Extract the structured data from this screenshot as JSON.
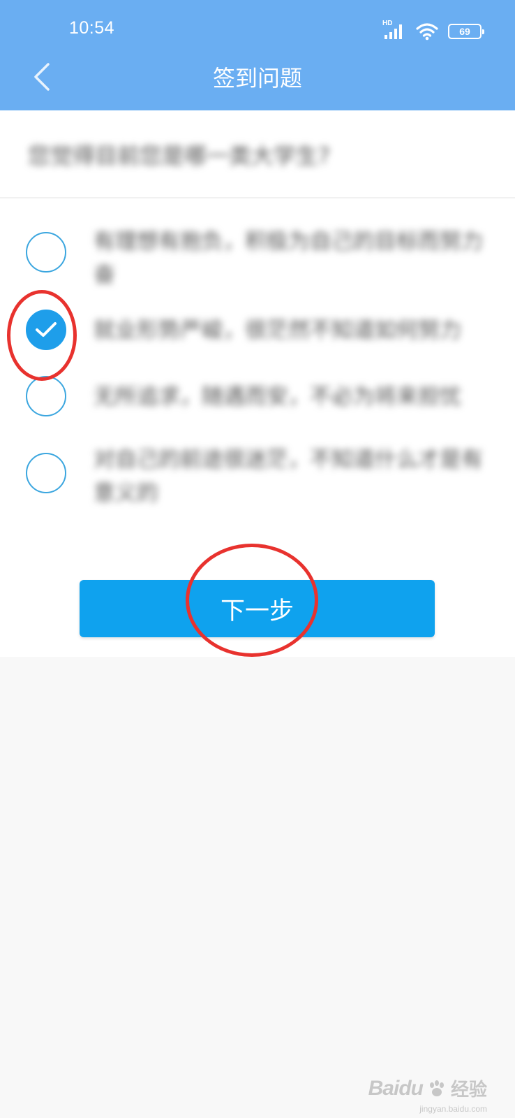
{
  "status_bar": {
    "time": "10:54",
    "network_label": "HD",
    "battery_level": "69"
  },
  "header": {
    "title": "签到问题"
  },
  "question": {
    "text": "您觉得目前您是哪一类大学生?"
  },
  "options": [
    {
      "text": "有理想有抱负，积极为自己的目标而努力奋",
      "checked": false
    },
    {
      "text": "就业形势严峻，很茫然不知道如何努力",
      "checked": true
    },
    {
      "text": "无所追求，随遇而安，不必为将来担忧",
      "checked": false
    },
    {
      "text": "对自己的前途很迷茫，不知道什么才是有意义的",
      "checked": false
    }
  ],
  "next_button": {
    "label": "下一步"
  },
  "watermark": {
    "logo_text": "Baidu",
    "cn_text": "经验",
    "url": "jingyan.baidu.com"
  },
  "colors": {
    "header_bg": "#6aaef2",
    "accent": "#0fa2ee",
    "annotation": "#e8322e"
  }
}
